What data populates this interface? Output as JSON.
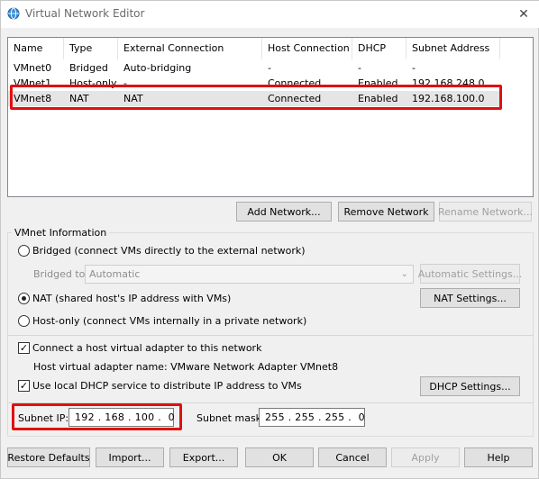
{
  "window": {
    "title": "Virtual Network Editor",
    "close_glyph": "✕"
  },
  "table": {
    "columns": [
      "Name",
      "Type",
      "External Connection",
      "Host Connection",
      "DHCP",
      "Subnet Address"
    ],
    "rows": [
      [
        "VMnet0",
        "Bridged",
        "Auto-bridging",
        "-",
        "-",
        "-"
      ],
      [
        "VMnet1",
        "Host-only",
        "-",
        "Connected",
        "Enabled",
        "192.168.248.0"
      ],
      [
        "VMnet8",
        "NAT",
        "NAT",
        "Connected",
        "Enabled",
        "192.168.100.0"
      ]
    ],
    "selected_row": 2
  },
  "buttons": {
    "add_network": "Add Network...",
    "remove_network": "Remove Network",
    "rename_network": "Rename Network...",
    "automatic_settings": "Automatic Settings...",
    "nat_settings": "NAT Settings...",
    "dhcp_settings": "DHCP Settings...",
    "restore_defaults": "Restore Defaults",
    "import": "Import...",
    "export": "Export...",
    "ok": "OK",
    "cancel": "Cancel",
    "apply": "Apply",
    "help": "Help"
  },
  "vmnet_info": {
    "group_label": "VMnet Information",
    "bridged_label": "Bridged (connect VMs directly to the external network)",
    "bridged_to_label": "Bridged to:",
    "bridged_to_value": "Automatic",
    "nat_label": "NAT (shared host's IP address with VMs)",
    "hostonly_label": "Host-only (connect VMs internally in a private network)",
    "selected_mode": "NAT",
    "connect_adapter_label": "Connect a host virtual adapter to this network",
    "connect_adapter_checked": true,
    "adapter_name_label": "Host virtual adapter name: VMware Network Adapter VMnet8",
    "dhcp_label": "Use local DHCP service to distribute IP address to VMs",
    "dhcp_checked": true,
    "subnet_ip_label": "Subnet IP:",
    "subnet_ip_value": "192 . 168 . 100 .  0",
    "subnet_mask_label": "Subnet mask:",
    "subnet_mask_value": "255 . 255 . 255 .  0"
  },
  "icons": {
    "app": "globe-network-icon",
    "close": "close-icon",
    "dropdown": "chevron-down-icon",
    "check": "checkmark-icon"
  },
  "colors": {
    "highlight": "#e01010",
    "selected_row": "#e5e5e5",
    "window_bg": "#f0f0f0"
  }
}
